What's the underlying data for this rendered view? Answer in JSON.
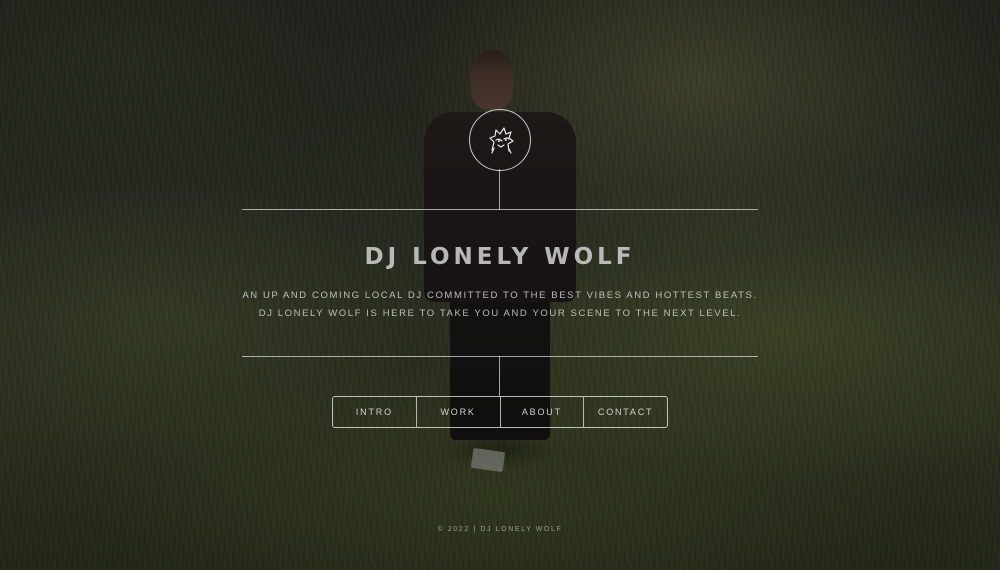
{
  "header": {
    "logo_icon": "wolf-head-logo-icon",
    "title": "DJ LONELY WOLF",
    "description_line1": "AN UP AND COMING LOCAL DJ COMMITTED TO THE BEST VIBES AND HOTTEST BEATS.",
    "description_line2": "DJ LONELY WOLF IS HERE TO TAKE YOU AND YOUR SCENE TO THE NEXT LEVEL."
  },
  "nav": {
    "items": [
      {
        "label": "INTRO"
      },
      {
        "label": "WORK"
      },
      {
        "label": "ABOUT"
      },
      {
        "label": "CONTACT"
      }
    ]
  },
  "footer": {
    "text": "© 2022 | DJ LONELY WOLF"
  },
  "colors": {
    "line": "#e6e6e6",
    "text": "#d2d2d2"
  }
}
